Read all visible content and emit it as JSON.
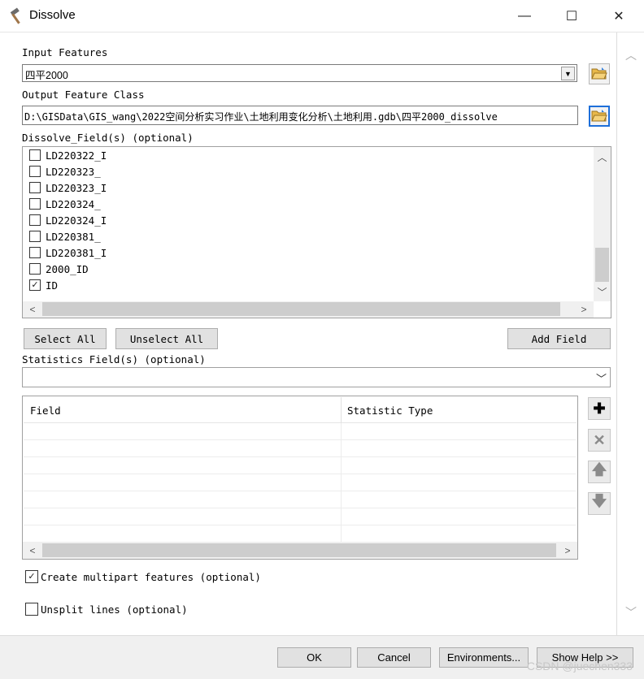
{
  "window": {
    "title": "Dissolve",
    "min_glyph": "—",
    "max_glyph": "☐",
    "close_glyph": "✕",
    "icon": "hammer-icon"
  },
  "input_features": {
    "label": "Input Features",
    "value": "四平2000"
  },
  "output_feature_class": {
    "label": "Output Feature Class",
    "value": "D:\\GISData\\GIS_wang\\2022空间分析实习作业\\土地利用变化分析\\土地利用.gdb\\四平2000_dissolve"
  },
  "dissolve_fields": {
    "label": "Dissolve_Field(s) (optional)",
    "items": [
      {
        "name": "LD220322_I",
        "checked": false
      },
      {
        "name": "LD220323_",
        "checked": false
      },
      {
        "name": "LD220323_I",
        "checked": false
      },
      {
        "name": "LD220324_",
        "checked": false
      },
      {
        "name": "LD220324_I",
        "checked": false
      },
      {
        "name": "LD220381_",
        "checked": false
      },
      {
        "name": "LD220381_I",
        "checked": false
      },
      {
        "name": "2000_ID",
        "checked": false
      },
      {
        "name": "ID",
        "checked": true
      }
    ]
  },
  "buttons": {
    "select_all": "Select All",
    "unselect_all": "Unselect All",
    "add_field": "Add Field"
  },
  "statistics": {
    "label": "Statistics Field(s) (optional)",
    "value": "",
    "columns": [
      "Field",
      "Statistic Type"
    ],
    "rows": []
  },
  "options": {
    "multipart": {
      "label": "Create multipart features (optional)",
      "checked": true
    },
    "unsplit": {
      "label": "Unsplit lines (optional)",
      "checked": false
    }
  },
  "footer": {
    "ok": "OK",
    "cancel": "Cancel",
    "environments": "Environments...",
    "show_help": "Show Help >>"
  },
  "watermark": "CSDN @juechen333",
  "colors": {
    "accent": "#1e6fd9",
    "folder": "#e8b84a"
  }
}
